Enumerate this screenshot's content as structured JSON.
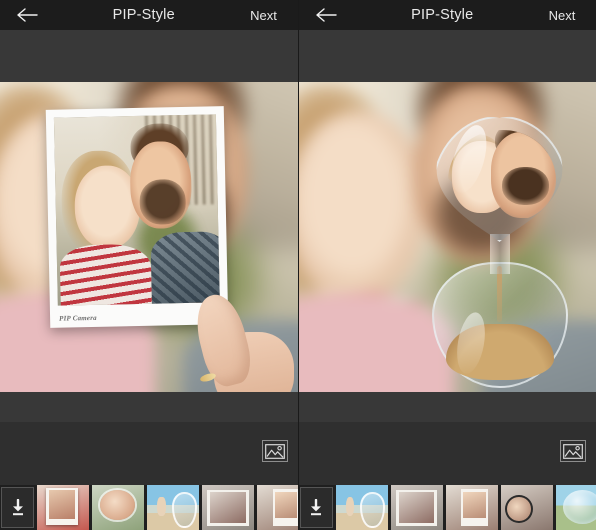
{
  "app": {
    "name": "PIP Camera",
    "watermark": "PIP Camera",
    "accent_selected": "#2f9bea",
    "header_bg": "#1c1c1c",
    "stage_bg": "#383838",
    "strip_bg": "#1f1f1f"
  },
  "panels": [
    {
      "id": "left",
      "header": {
        "back_icon": "arrow-left-icon",
        "title": "PIP-Style",
        "next_label": "Next"
      },
      "preview": {
        "effect": "polaroid-frame",
        "description": "Blurred couple selfie background with sharp polaroid photo held by a hand",
        "watermark": "PIP Camera"
      },
      "toolbar": {
        "gallery_icon": "image-picker-icon"
      },
      "strip": {
        "download_icon": "download-icon",
        "selected_index": 0,
        "thumbnails": [
          {
            "name": "polaroid-frame",
            "style": "t-frame t-red",
            "selected": true
          },
          {
            "name": "circle-bubble",
            "style": "t-circ",
            "selected": false
          },
          {
            "name": "beach-hourglass",
            "style": "t-beach",
            "selected": false
          },
          {
            "name": "kiss-frame",
            "style": "t-kiss",
            "selected": false
          },
          {
            "name": "selfie-frame",
            "style": "t-sel",
            "selected": false
          }
        ]
      }
    },
    {
      "id": "right",
      "header": {
        "back_icon": "arrow-left-icon",
        "title": "PIP-Style",
        "next_label": "Next"
      },
      "preview": {
        "effect": "hourglass-heart",
        "description": "Blurred couple selfie background with sharp faces inside a heart-shaped hourglass",
        "watermark": ""
      },
      "toolbar": {
        "gallery_icon": "image-picker-icon"
      },
      "strip": {
        "download_icon": "download-icon",
        "selected_index": 0,
        "thumbnails": [
          {
            "name": "beach-hourglass",
            "style": "t-beach",
            "selected": true
          },
          {
            "name": "kiss-frame",
            "style": "t-kiss",
            "selected": false
          },
          {
            "name": "selfie-frame",
            "style": "t-sel",
            "selected": false
          },
          {
            "name": "sunglasses-frame",
            "style": "t-glass",
            "selected": false
          },
          {
            "name": "bubble-frame",
            "style": "t-bub",
            "selected": false
          }
        ]
      }
    }
  ]
}
